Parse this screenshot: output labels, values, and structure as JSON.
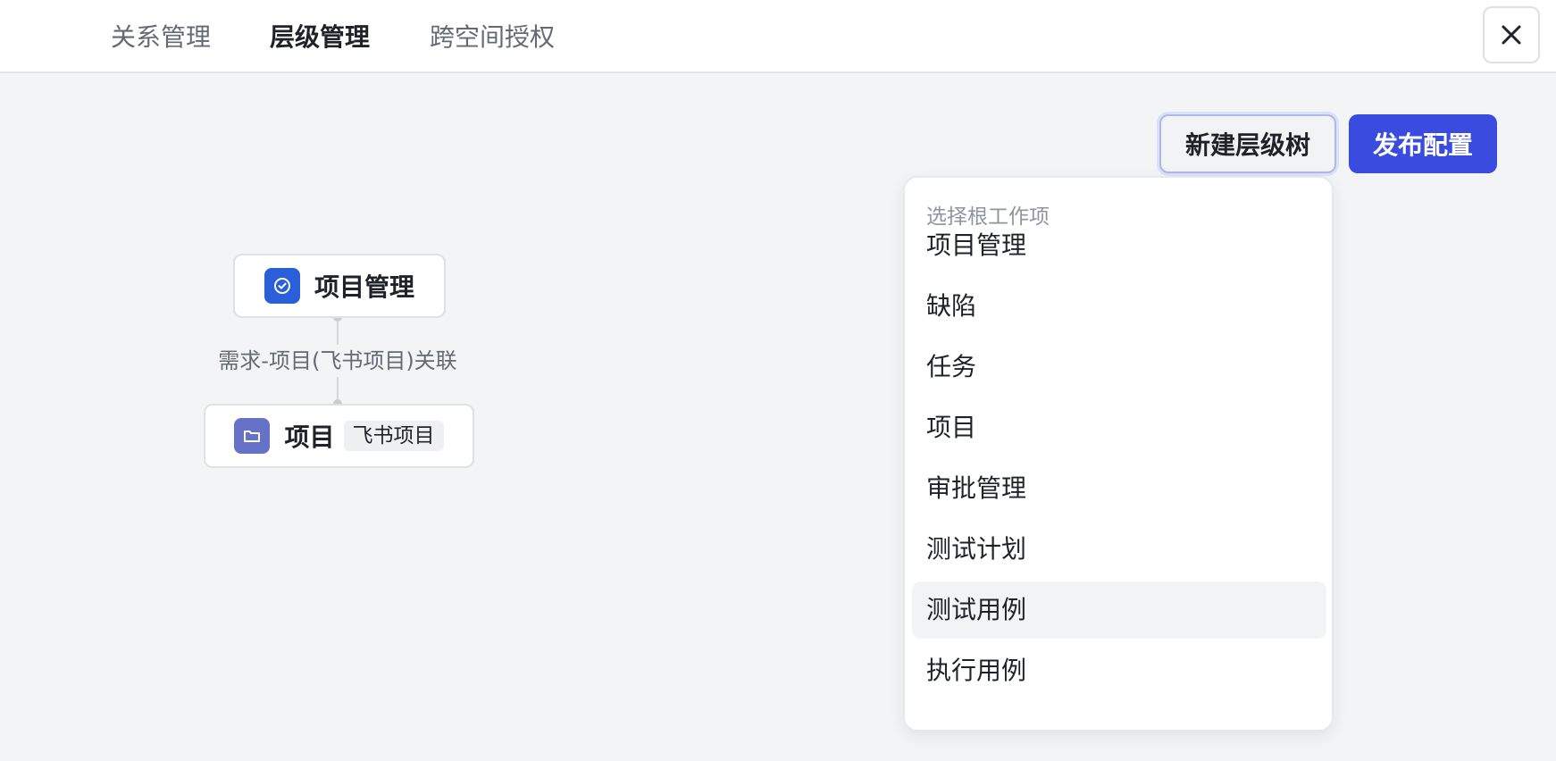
{
  "tabs": [
    {
      "label": "关系管理",
      "active": false
    },
    {
      "label": "层级管理",
      "active": true
    },
    {
      "label": "跨空间授权",
      "active": false
    }
  ],
  "close_icon": "close-icon",
  "toolbar": {
    "new_tree_label": "新建层级树",
    "publish_label": "发布配置"
  },
  "hierarchy": {
    "root": {
      "label": "项目管理",
      "icon": "check-circle-icon",
      "icon_color": "#2b5fd9"
    },
    "edge_label": "需求-项目(飞书项目)关联",
    "child": {
      "label": "项目",
      "tag": "飞书项目",
      "icon": "folder-icon",
      "icon_color": "#6572c6"
    }
  },
  "dropdown": {
    "header": "选择根工作项",
    "items": [
      "项目管理",
      "缺陷",
      "任务",
      "项目",
      "审批管理",
      "测试计划",
      "测试用例",
      "执行用例"
    ],
    "highlighted_index": 6
  },
  "colors": {
    "accent": "#3a4ce0",
    "background": "#f3f4f6"
  }
}
